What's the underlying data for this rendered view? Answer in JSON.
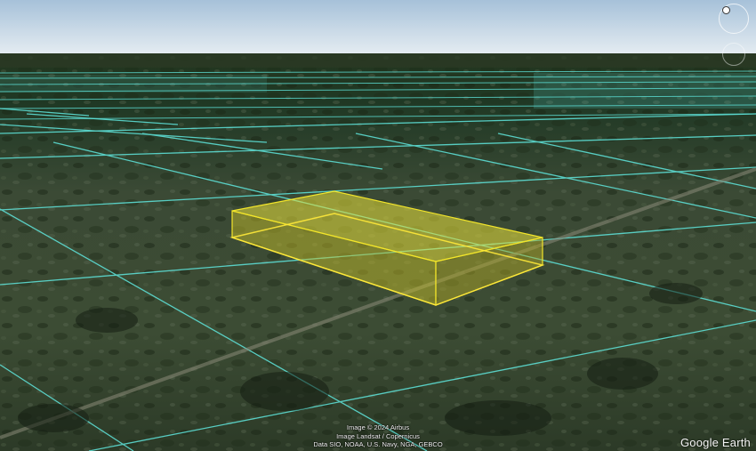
{
  "app": {
    "name": "Google Earth"
  },
  "attribution": {
    "line1": "Image © 2024 Airbus",
    "line2": "Image Landsat / Copernicus",
    "line3": "Data SIO, NOAA, U.S. Navy, NGA, GEBCO"
  },
  "logo": {
    "text": "Google Earth"
  },
  "icons": {
    "compass": "compass-icon",
    "tilt": "tilt-control-icon"
  },
  "colors": {
    "sky_top": "#a9c4dc",
    "sky_bottom": "#e2ebf2",
    "parcel_grid": "#5fe6dd",
    "polygon_fill": "#e8e03a",
    "polygon_stroke": "#f2e52a",
    "terrain": "#3a4a32"
  }
}
